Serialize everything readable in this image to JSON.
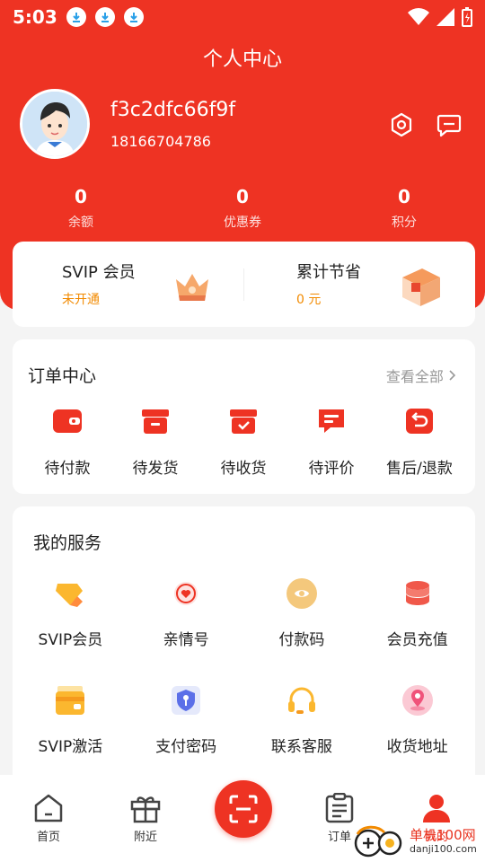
{
  "status_bar": {
    "time": "5:03"
  },
  "header": {
    "title": "个人中心",
    "username": "f3c2dfc66f9f",
    "phone": "18166704786",
    "settings_icon": "hexagon-settings-icon",
    "message_icon": "message-icon"
  },
  "stats": [
    {
      "value": "0",
      "label": "余额"
    },
    {
      "value": "0",
      "label": "优惠券"
    },
    {
      "value": "0",
      "label": "积分"
    }
  ],
  "svip": {
    "member_title": "SVIP 会员",
    "member_status": "未开通",
    "savings_title": "累计节省",
    "savings_value": "0 元"
  },
  "orders": {
    "title": "订单中心",
    "view_all": "查看全部",
    "items": [
      {
        "label": "待付款",
        "icon": "wallet-icon"
      },
      {
        "label": "待发货",
        "icon": "box-icon"
      },
      {
        "label": "待收货",
        "icon": "box-check-icon"
      },
      {
        "label": "待评价",
        "icon": "comment-icon"
      },
      {
        "label": "售后/退款",
        "icon": "return-icon"
      }
    ]
  },
  "services": {
    "title": "我的服务",
    "items": [
      {
        "label": "SVIP会员",
        "icon": "diamond-icon"
      },
      {
        "label": "亲情号",
        "icon": "heart-chat-icon"
      },
      {
        "label": "付款码",
        "icon": "payment-code-icon"
      },
      {
        "label": "会员充值",
        "icon": "coin-stack-icon"
      },
      {
        "label": "SVIP激活",
        "icon": "card-box-icon"
      },
      {
        "label": "支付密码",
        "icon": "shield-key-icon"
      },
      {
        "label": "联系客服",
        "icon": "headset-icon"
      },
      {
        "label": "收货地址",
        "icon": "location-icon"
      }
    ]
  },
  "tabbar": [
    {
      "label": "首页",
      "icon": "home-icon"
    },
    {
      "label": "附近",
      "icon": "gift-icon"
    },
    {
      "label": "订单",
      "icon": "order-list-icon"
    },
    {
      "label": "我的",
      "icon": "user-icon"
    }
  ],
  "watermark": {
    "text": "单机100网",
    "sub": "danji100.com"
  },
  "colors": {
    "primary": "#ee3323",
    "accent_orange": "#f28a00",
    "page_bg": "#f4f4f4"
  }
}
